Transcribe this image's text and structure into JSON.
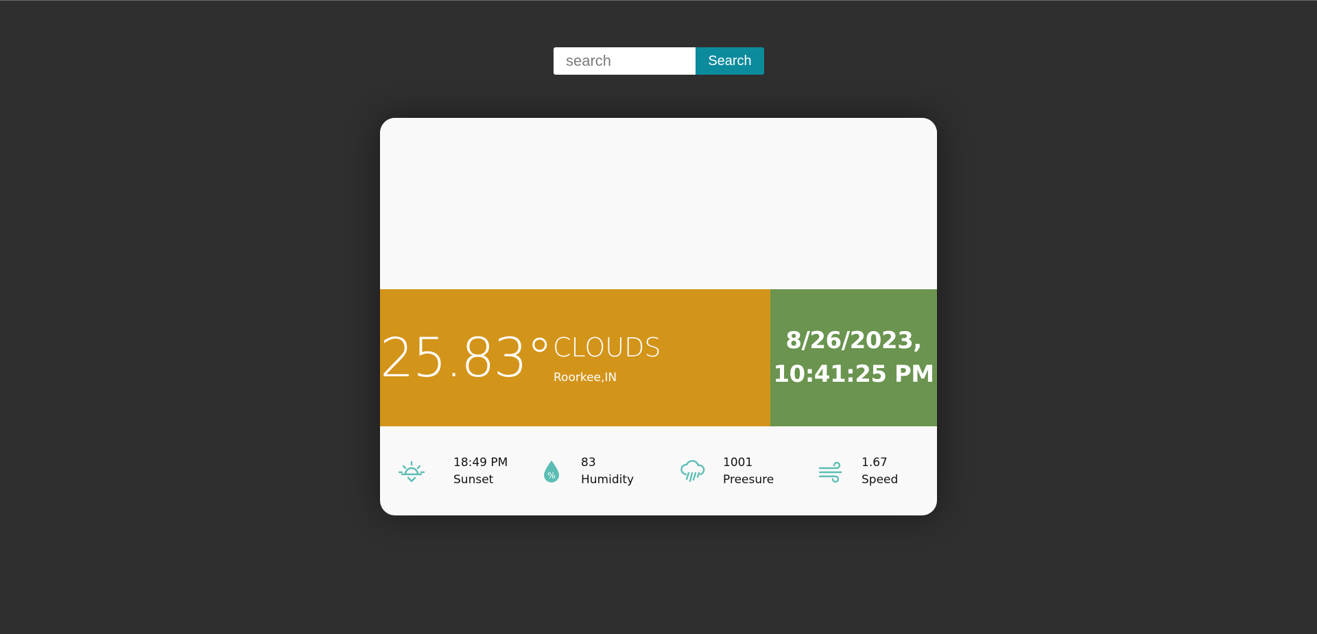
{
  "search": {
    "placeholder": "search",
    "value": "",
    "button_label": "Search"
  },
  "weather": {
    "temperature": "25.83°",
    "condition": "CLOUDS",
    "location": "Roorkee,IN"
  },
  "datetime": {
    "date": "8/26/2023,",
    "time": "10:41:25 PM"
  },
  "stats": [
    {
      "icon": "sunset-icon",
      "value": "18:49 PM",
      "label": "Sunset"
    },
    {
      "icon": "humidity-icon",
      "value": "83",
      "label": "Humidity"
    },
    {
      "icon": "rain-cloud-icon",
      "value": "1001",
      "label": "Preesure"
    },
    {
      "icon": "wind-icon",
      "value": "1.67",
      "label": "Speed"
    }
  ],
  "colors": {
    "background": "#2f2f2f",
    "search_button": "#0c8b9d",
    "weather_panel": "#d3941a",
    "datetime_panel": "#6a944f",
    "icon": "#5cbdb4"
  }
}
